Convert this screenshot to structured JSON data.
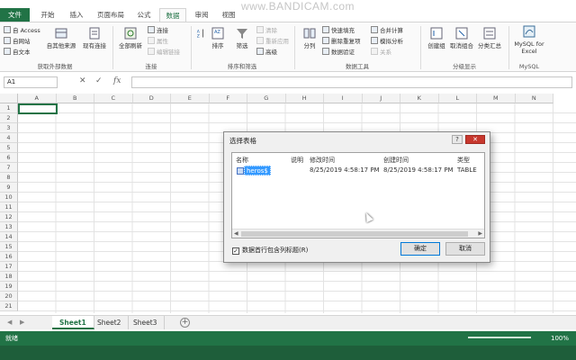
{
  "watermark": "www.BANDICAM.com",
  "ribbon_tabs": [
    "文件",
    "开始",
    "插入",
    "页面布局",
    "公式",
    "数据",
    "审阅",
    "视图"
  ],
  "ribbon": {
    "get_external": {
      "items": [
        "自 Access",
        "自网站",
        "自文本"
      ],
      "other_sources": "自其他来源",
      "existing": "现有连接",
      "label": "获取外部数据"
    },
    "connections": {
      "refresh_all": "全部刷新",
      "items": [
        "连接",
        "属性",
        "编辑链接"
      ],
      "label": "连接"
    },
    "sort_filter": {
      "sort_az": "排序",
      "filter": "筛选",
      "items": [
        "清除",
        "重新应用",
        "高级"
      ],
      "label": "排序和筛选"
    },
    "data_tools": {
      "split": "分列",
      "items": [
        "快速填充",
        "删除重复项",
        "数据验证",
        "合并计算",
        "模拟分析",
        "关系"
      ],
      "label": "数据工具"
    },
    "outline": {
      "items": [
        "创建组",
        "取消组合",
        "分类汇总"
      ],
      "label": "分级显示"
    },
    "mysql": {
      "button": "MySQL for Excel",
      "label": "MySQL"
    }
  },
  "formula_bar": {
    "name_box": "A1",
    "fx": "fx",
    "cancel": "✕",
    "enter": "✓"
  },
  "columns": [
    "A",
    "B",
    "C",
    "D",
    "E",
    "F",
    "G",
    "H",
    "I",
    "J",
    "K",
    "L",
    "M",
    "N"
  ],
  "rows": [
    "1",
    "2",
    "3",
    "4",
    "5",
    "6",
    "7",
    "8",
    "9",
    "10",
    "11",
    "12",
    "13",
    "14",
    "15",
    "16",
    "17",
    "18",
    "19",
    "20",
    "21"
  ],
  "sheets": [
    "Sheet1",
    "Sheet2",
    "Sheet3"
  ],
  "active_sheet": "Sheet1",
  "status": {
    "ready": "就绪",
    "zoom": "100%"
  },
  "dialog": {
    "title": "选择表格",
    "headers": [
      "名称",
      "说明",
      "修改时间",
      "创建时间",
      "类型"
    ],
    "row": {
      "name": "heros$",
      "description": "",
      "modified": "8/25/2019 4:58:17 PM",
      "created": "8/25/2019 4:58:17 PM",
      "type": "TABLE"
    },
    "checkbox_label": "数据首行包含列标题(R)",
    "checkbox_checked": true,
    "ok": "确定",
    "cancel": "取消",
    "help": "?",
    "close": "✕"
  },
  "colors": {
    "accent": "#217346",
    "status_bar": "#217346",
    "selection": "#3399ff"
  }
}
